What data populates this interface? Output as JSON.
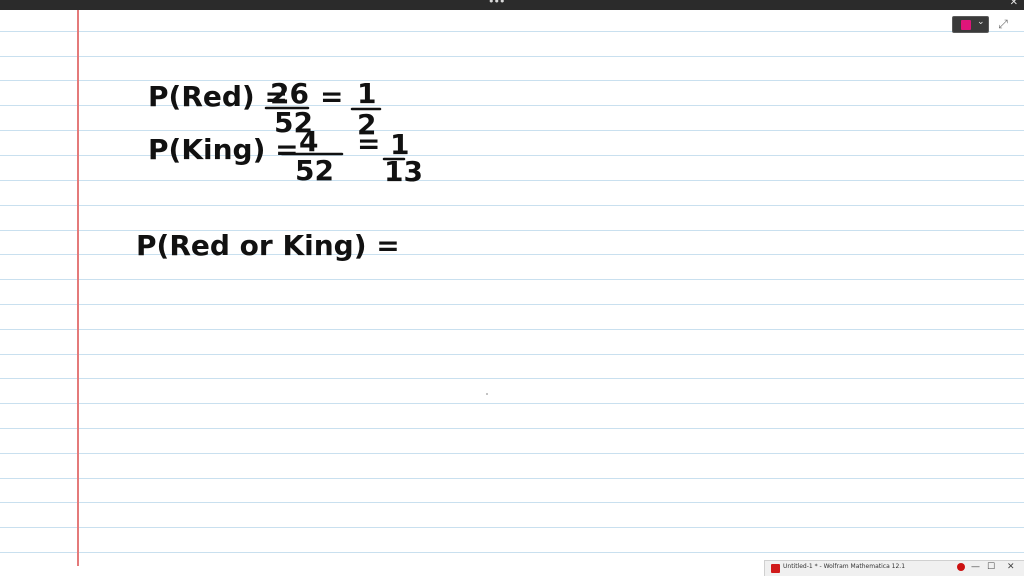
{
  "window": {
    "menu_icon": "more-dots-icon",
    "menu_glyph": "•••",
    "close_glyph": "✕"
  },
  "toolbar": {
    "pen_color": "#e0157a",
    "chevron_glyph": "⌄",
    "expand_glyph": "⤢"
  },
  "notebook": {
    "line_color": "#c9e0ef",
    "margin_color": "#e47a7a",
    "ink_color": "#111111",
    "line1": {
      "label": "P(Red) =",
      "num": "26",
      "den": "52",
      "eq": "=",
      "rnum": "1",
      "rden": "2"
    },
    "line2": {
      "label": "P(King) =",
      "num": "4",
      "den": "52",
      "eq": "=",
      "rnum": "1",
      "rden": "13"
    },
    "line3": {
      "label": "P(Red or King) ="
    }
  },
  "taskbar": {
    "title": "Untitled-1 * - Wolfram Mathematica 12.1",
    "min_glyph": "—",
    "max_glyph": "☐",
    "close_glyph": "✕"
  }
}
